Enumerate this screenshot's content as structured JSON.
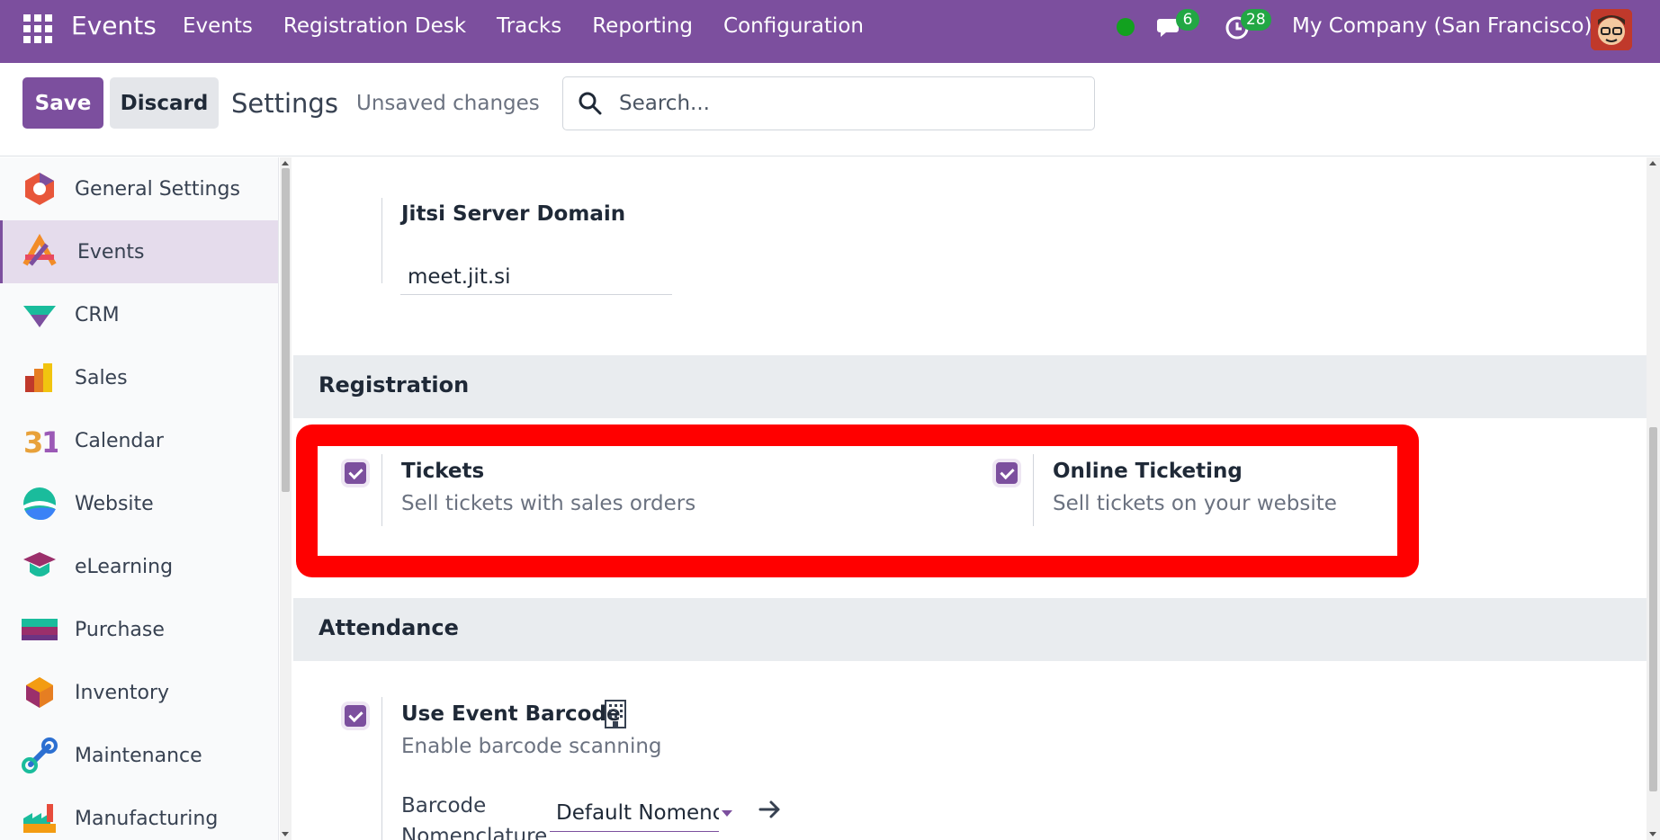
{
  "navbar": {
    "brand": "Events",
    "menu": [
      "Events",
      "Registration Desk",
      "Tracks",
      "Reporting",
      "Configuration"
    ],
    "chat_count": "6",
    "activity_count": "28",
    "company": "My Company (San Francisco)"
  },
  "control": {
    "save_label": "Save",
    "discard_label": "Discard",
    "title": "Settings",
    "unsaved": "Unsaved changes",
    "search_placeholder": "Search..."
  },
  "sidebar": {
    "items": [
      {
        "label": "General Settings",
        "icon": "general-settings-icon"
      },
      {
        "label": "Events",
        "icon": "events-icon",
        "active": true
      },
      {
        "label": "CRM",
        "icon": "crm-icon"
      },
      {
        "label": "Sales",
        "icon": "sales-icon"
      },
      {
        "label": "Calendar",
        "icon": "calendar-icon"
      },
      {
        "label": "Website",
        "icon": "website-icon"
      },
      {
        "label": "eLearning",
        "icon": "elearning-icon"
      },
      {
        "label": "Purchase",
        "icon": "purchase-icon"
      },
      {
        "label": "Inventory",
        "icon": "inventory-icon"
      },
      {
        "label": "Maintenance",
        "icon": "maintenance-icon"
      },
      {
        "label": "Manufacturing",
        "icon": "manufacturing-icon"
      }
    ]
  },
  "main": {
    "jitsi": {
      "label": "Jitsi Server Domain",
      "value": "meet.jit.si"
    },
    "registration": {
      "title": "Registration",
      "tickets": {
        "label": "Tickets",
        "desc": "Sell tickets with sales orders",
        "checked": true
      },
      "online": {
        "label": "Online Ticketing",
        "desc": "Sell tickets on your website",
        "checked": true
      }
    },
    "attendance": {
      "title": "Attendance",
      "barcode": {
        "label": "Use Event Barcode",
        "desc": "Enable barcode scanning",
        "checked": true
      },
      "nomenclature_label_1": "Barcode",
      "nomenclature_label_2": "Nomenclature",
      "nomenclature_value": "Default Nomenc"
    }
  },
  "colors": {
    "brand": "#7c4f9e",
    "highlight": "#ff0000",
    "badge": "#22a744"
  }
}
